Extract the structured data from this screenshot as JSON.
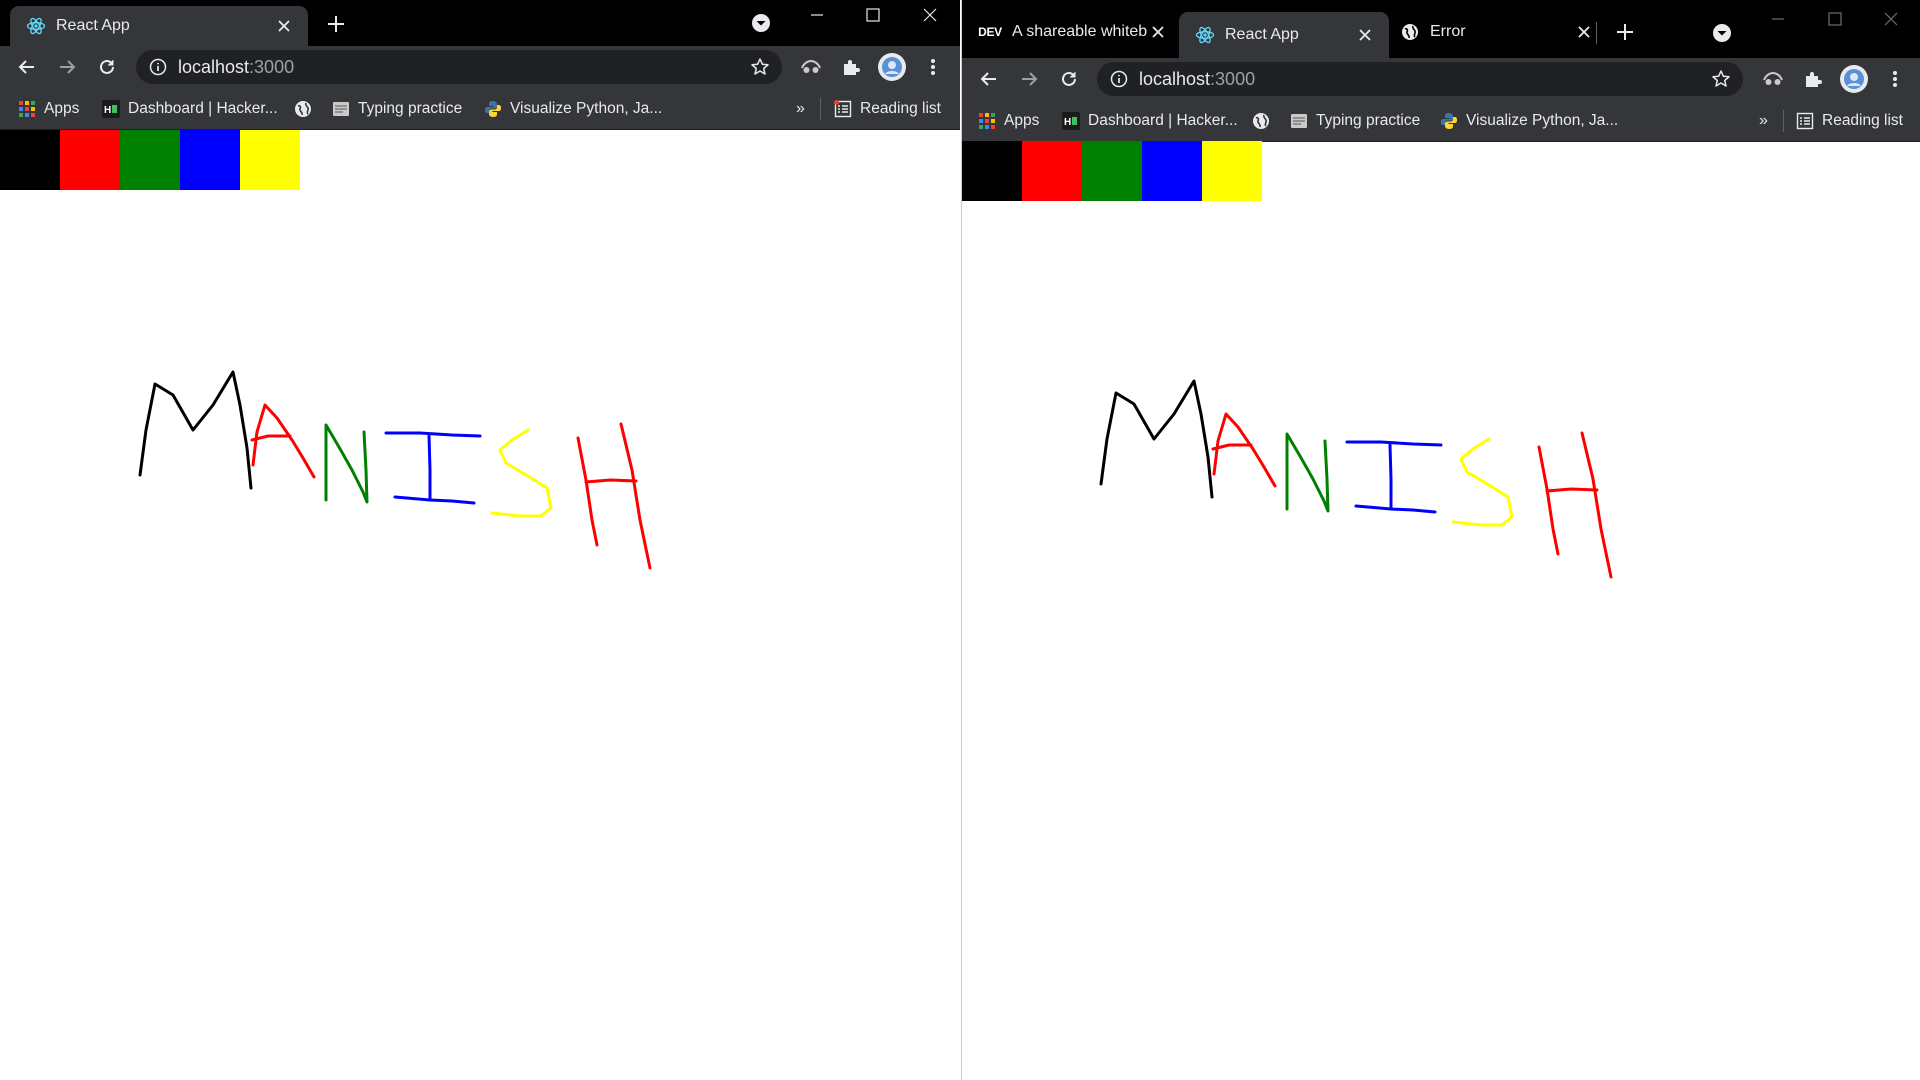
{
  "left_window": {
    "tabs": [
      {
        "title": "React App",
        "icon": "react-icon",
        "active": true
      }
    ],
    "toolbar": {
      "url_host": "localhost",
      "url_port": ":3000"
    },
    "bookmarks": [
      {
        "label": "Apps",
        "icon": "apps-grid-icon"
      },
      {
        "label": "Dashboard | Hacker...",
        "icon": "hackerearth-icon"
      },
      {
        "label": "",
        "icon": "globe-icon"
      },
      {
        "label": "Typing practice",
        "icon": "typing-icon"
      },
      {
        "label": "Visualize Python, Ja...",
        "icon": "python-icon"
      }
    ],
    "overflow_label": "»",
    "reading_list": "Reading list"
  },
  "right_window": {
    "tabs": [
      {
        "title": "A shareable whiteb",
        "icon": "dev-icon",
        "badge": "DEV",
        "active": false
      },
      {
        "title": "React App",
        "icon": "react-icon",
        "active": true
      },
      {
        "title": "Error",
        "icon": "globe-icon",
        "active": false
      }
    ],
    "toolbar": {
      "url_host": "localhost",
      "url_port": ":3000"
    },
    "bookmarks": [
      {
        "label": "Apps",
        "icon": "apps-grid-icon"
      },
      {
        "label": "Dashboard | Hacker...",
        "icon": "hackerearth-icon"
      },
      {
        "label": "",
        "icon": "globe-icon"
      },
      {
        "label": "Typing practice",
        "icon": "typing-icon"
      },
      {
        "label": "Visualize Python, Ja...",
        "icon": "python-icon"
      }
    ],
    "overflow_label": "»",
    "reading_list": "Reading list"
  },
  "whiteboard": {
    "palette": [
      {
        "name": "black",
        "color": "#000000"
      },
      {
        "name": "red",
        "color": "#ff0000"
      },
      {
        "name": "green",
        "color": "#008000"
      },
      {
        "name": "blue",
        "color": "#0000ff"
      },
      {
        "name": "yellow",
        "color": "#ffff00"
      }
    ],
    "drawn_letters": [
      {
        "letter": "M",
        "color": "#000000"
      },
      {
        "letter": "A",
        "color": "#ff0000"
      },
      {
        "letter": "N",
        "color": "#008000"
      },
      {
        "letter": "I",
        "color": "#0000ff"
      },
      {
        "letter": "S",
        "color": "#ffff00"
      },
      {
        "letter": "H",
        "color": "#ff0000"
      }
    ]
  },
  "colors": {
    "tab_strip": "#000000",
    "toolbar": "#35363a",
    "omnibox": "#202124",
    "text": "#e8eaed"
  }
}
